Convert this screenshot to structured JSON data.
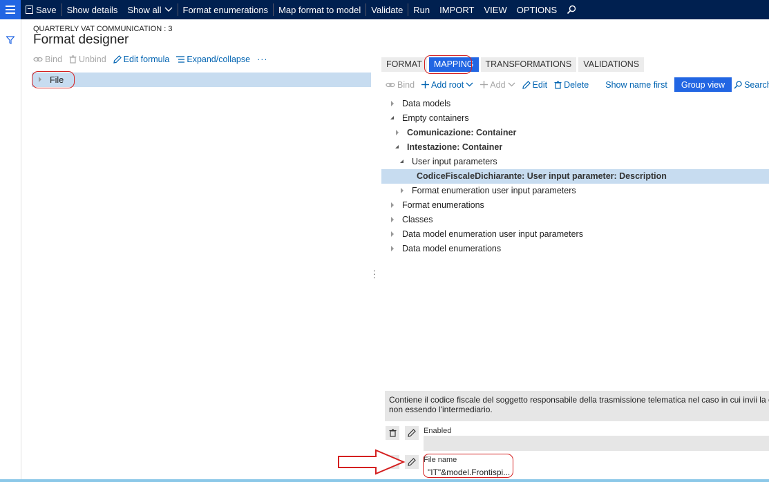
{
  "topbar": {
    "save": "Save",
    "show_details": "Show details",
    "show_all": "Show all",
    "format_enumerations": "Format enumerations",
    "map_format_to_model": "Map format to model",
    "validate": "Validate",
    "run": "Run",
    "import": "IMPORT",
    "view": "VIEW",
    "options": "OPTIONS"
  },
  "header": {
    "breadcrumb": "QUARTERLY VAT COMMUNICATION : 3",
    "title": "Format designer"
  },
  "left_toolbar": {
    "bind": "Bind",
    "unbind": "Unbind",
    "edit_formula": "Edit formula",
    "expand_collapse": "Expand/collapse",
    "more": "···"
  },
  "left_tree": {
    "file": "File"
  },
  "tabs": [
    "FORMAT",
    "MAPPING",
    "TRANSFORMATIONS",
    "VALIDATIONS"
  ],
  "active_tab": "MAPPING",
  "right_toolbar": {
    "bind": "Bind",
    "add_root": "Add root",
    "add": "Add",
    "edit": "Edit",
    "delete": "Delete",
    "show_name_first": "Show name first",
    "group_view": "Group view",
    "search": "Search"
  },
  "tree": [
    {
      "label": "Data models"
    },
    {
      "label": "Empty containers"
    },
    {
      "label": "Comunicazione: Container"
    },
    {
      "label": "Intestazione: Container"
    },
    {
      "label": "User input parameters"
    },
    {
      "label": "CodiceFiscaleDichiarante: User input parameter: Description"
    },
    {
      "label": "Format enumeration user input parameters"
    },
    {
      "label": "Format enumerations"
    },
    {
      "label": "Classes"
    },
    {
      "label": "Data model enumeration user input parameters"
    },
    {
      "label": "Data model enumerations"
    }
  ],
  "description": {
    "line1": "Contiene il codice fiscale del soggetto responsabile della trasmissione telematica nel caso in cui invii la c",
    "line2": "non essendo l'intermediario."
  },
  "enabled": {
    "label": "Enabled",
    "value": ""
  },
  "file_name": {
    "label": "File name",
    "value": "\"IT\"&model.Frontispi..."
  },
  "colors": {
    "topbar": "#002050",
    "accent": "#2266e3",
    "selection": "#c7dcf0",
    "annotation": "#d42020"
  }
}
